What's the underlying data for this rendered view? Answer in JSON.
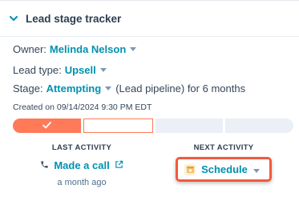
{
  "header": {
    "title": "Lead stage tracker",
    "icon": "chevron-down-icon"
  },
  "fields": {
    "owner_label": "Owner:",
    "owner_value": "Melinda Nelson",
    "lead_type_label": "Lead type:",
    "lead_type_value": "Upsell",
    "stage_label": "Stage:",
    "stage_value": "Attempting",
    "stage_suffix": "(Lead pipeline) for 6 months"
  },
  "created": "Created on 09/14/2024 9:30 PM EDT",
  "progress": {
    "states": [
      "done",
      "current",
      "todo",
      "todo"
    ],
    "accent": "#ff7a59"
  },
  "last_activity": {
    "label": "LAST ACTIVITY",
    "action": "Made a call",
    "time": "a month ago",
    "icon": "phone-icon"
  },
  "next_activity": {
    "label": "NEXT ACTIVITY",
    "action": "Schedule",
    "icon": "calendar-icon"
  }
}
